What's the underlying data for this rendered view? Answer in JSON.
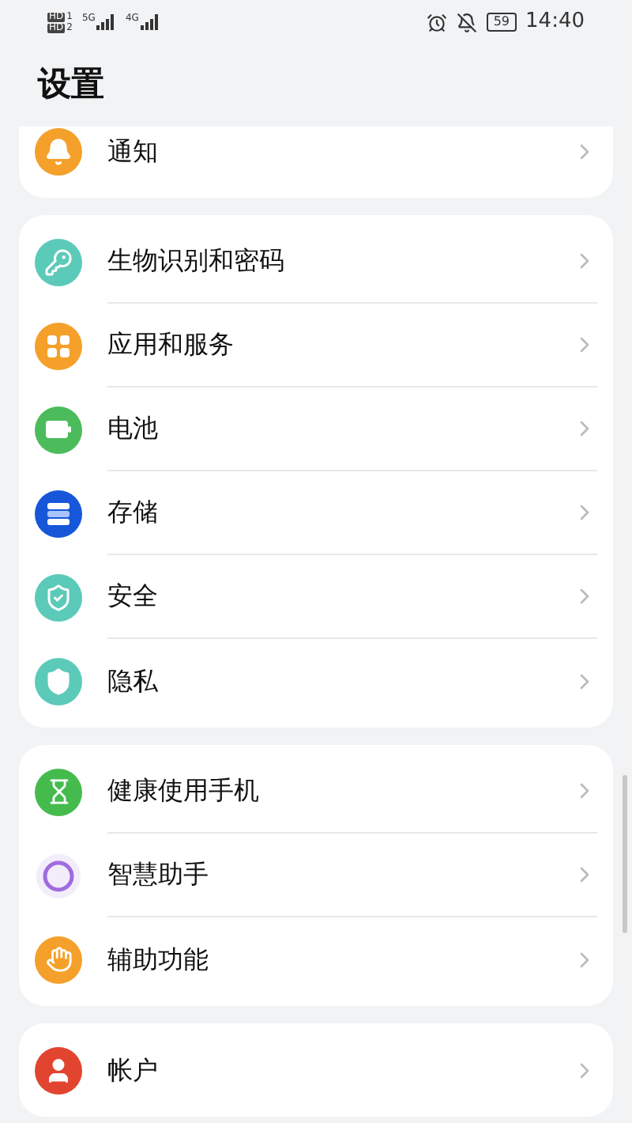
{
  "status_bar": {
    "sims": [
      {
        "label": "HD",
        "slot": "1"
      },
      {
        "label": "HD",
        "slot": "2"
      }
    ],
    "networks": [
      "5G",
      "4G"
    ],
    "battery": "59",
    "time": "14:40"
  },
  "title": "设置",
  "groups": [
    {
      "cut_top": true,
      "items": [
        {
          "label": "通知",
          "kind": "bell",
          "color": "#f5a02a"
        }
      ]
    },
    {
      "cut_top": false,
      "items": [
        {
          "label": "生物识别和密码",
          "kind": "key",
          "color": "#5ccab8"
        },
        {
          "label": "应用和服务",
          "kind": "apps",
          "color": "#f5a02a"
        },
        {
          "label": "电池",
          "kind": "battery",
          "color": "#4cbb5c"
        },
        {
          "label": "存储",
          "kind": "storage",
          "color": "#1657d9"
        },
        {
          "label": "安全",
          "kind": "shield",
          "color": "#5ccab8"
        },
        {
          "label": "隐私",
          "kind": "privacy",
          "color": "#5ccab8"
        }
      ]
    },
    {
      "cut_top": false,
      "items": [
        {
          "label": "健康使用手机",
          "kind": "hourglass",
          "color": "#45bb4e"
        },
        {
          "label": "智慧助手",
          "kind": "ring",
          "color": "#a06be0"
        },
        {
          "label": "辅助功能",
          "kind": "hand",
          "color": "#f5a02a"
        }
      ]
    },
    {
      "cut_top": false,
      "items": [
        {
          "label": "帐户",
          "kind": "user",
          "color": "#e2452f"
        }
      ]
    }
  ]
}
